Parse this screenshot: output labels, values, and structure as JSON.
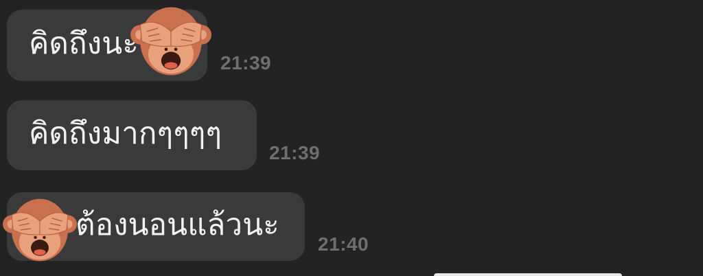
{
  "messages": [
    {
      "text": "คิดถึงนะ",
      "time": "21:39",
      "emoji": "see-no-evil-monkey"
    },
    {
      "text": "คิดถึงมากๆๆๆๆ",
      "time": "21:39"
    },
    {
      "text": "ต้องนอนแล้วนะ",
      "time": "21:40",
      "emoji": "see-no-evil-monkey"
    }
  ],
  "colors": {
    "background": "#232323",
    "bubble": "#3a3a3a",
    "text": "#f2f2f2",
    "timestamp": "#6f6f6f",
    "monkey_fur": "#c9704e",
    "monkey_face": "#e9a07c"
  }
}
